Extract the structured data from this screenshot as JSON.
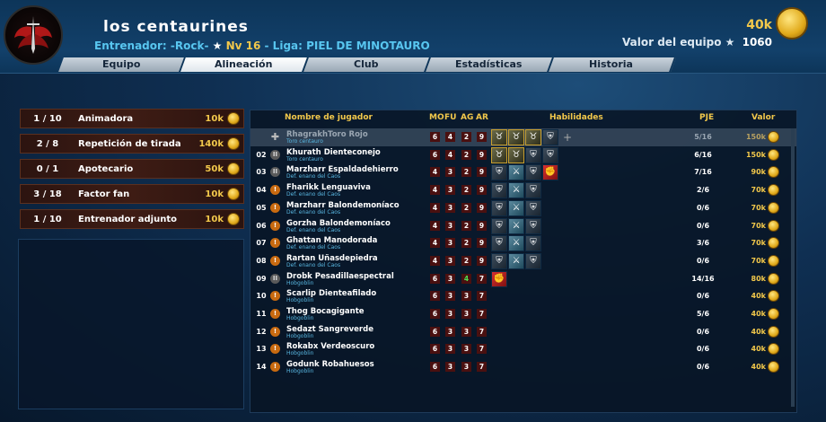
{
  "header": {
    "team_name": "los centaurines",
    "coach_prefix": "Entrenador: ",
    "coach": "-Rock-",
    "level": "Nv 16",
    "league_prefix": " - Liga: ",
    "league": "PIEL DE MINOTAURO",
    "money": "40k",
    "team_value_label": "Valor del equipo",
    "team_value": "1060"
  },
  "nav": {
    "items": [
      "Equipo",
      "Alineación",
      "Club",
      "Estadísticas",
      "Historia"
    ],
    "active": "Alineación"
  },
  "staff": [
    {
      "count": "1 / 10",
      "name": "Animadora",
      "price": "10k"
    },
    {
      "count": "2 / 8",
      "name": "Repetición de tirada",
      "price": "140k"
    },
    {
      "count": "0 / 1",
      "name": "Apotecario",
      "price": "50k"
    },
    {
      "count": "3 / 18",
      "name": "Factor fan",
      "price": "10k"
    },
    {
      "count": "1 / 10",
      "name": "Entrenador adjunto",
      "price": "10k"
    }
  ],
  "roster_headers": {
    "name": "Nombre de jugador",
    "mo": "MO",
    "fu": "FU",
    "ag": "AG",
    "ar": "AR",
    "skills": "Habilidades",
    "pje": "PJE",
    "value": "Valor"
  },
  "players": [
    {
      "num": "",
      "status": "cross",
      "name": "RhagrakhToro Rojo",
      "type": "Toro centauro",
      "mo": "6",
      "fu": "4",
      "ag": "2",
      "ar": "9",
      "skills": [
        "horn",
        "horn",
        "horn",
        "shield",
        "plus"
      ],
      "pje": "5/16",
      "value": "150k"
    },
    {
      "num": "02",
      "status": "two",
      "name": "Khurath Dienteconejo",
      "type": "Toro centauro",
      "mo": "6",
      "fu": "4",
      "ag": "2",
      "ar": "9",
      "skills": [
        "horn",
        "horn",
        "shield",
        "shield"
      ],
      "pje": "6/16",
      "value": "150k"
    },
    {
      "num": "03",
      "status": "two",
      "name": "Marzharr Espaldadehierro",
      "type": "Def. enano del Caos",
      "mo": "4",
      "fu": "3",
      "ag": "2",
      "ar": "9",
      "skills": [
        "shield",
        "claw",
        "shield",
        "red"
      ],
      "pje": "7/16",
      "value": "90k"
    },
    {
      "num": "04",
      "status": "warn",
      "name": "Fharikk Lenguaviva",
      "type": "Def. enano del Caos",
      "mo": "4",
      "fu": "3",
      "ag": "2",
      "ar": "9",
      "skills": [
        "shield",
        "claw",
        "shield"
      ],
      "pje": "2/6",
      "value": "70k"
    },
    {
      "num": "05",
      "status": "warn",
      "name": "Marzharr Balondemoníaco",
      "type": "Def. enano del Caos",
      "mo": "4",
      "fu": "3",
      "ag": "2",
      "ar": "9",
      "skills": [
        "shield",
        "claw",
        "shield"
      ],
      "pje": "0/6",
      "value": "70k"
    },
    {
      "num": "06",
      "status": "warn",
      "name": "Gorzha Balondemoníaco",
      "type": "Def. enano del Caos",
      "mo": "4",
      "fu": "3",
      "ag": "2",
      "ar": "9",
      "skills": [
        "shield",
        "claw",
        "shield"
      ],
      "pje": "0/6",
      "value": "70k"
    },
    {
      "num": "07",
      "status": "warn",
      "name": "Ghattan Manodorada",
      "type": "Def. enano del Caos",
      "mo": "4",
      "fu": "3",
      "ag": "2",
      "ar": "9",
      "skills": [
        "shield",
        "claw",
        "shield"
      ],
      "pje": "3/6",
      "value": "70k"
    },
    {
      "num": "08",
      "status": "warn",
      "name": "Rartan Uñasdepiedra",
      "type": "Def. enano del Caos",
      "mo": "4",
      "fu": "3",
      "ag": "2",
      "ar": "9",
      "skills": [
        "shield",
        "claw",
        "shield"
      ],
      "pje": "0/6",
      "value": "70k"
    },
    {
      "num": "09",
      "status": "two",
      "name": "Drobk Pesadillaespectral",
      "type": "Hobgoblin",
      "mo": "6",
      "fu": "3",
      "ag": "4",
      "ar": "7",
      "skills": [
        "red"
      ],
      "pje": "14/16",
      "value": "80k",
      "ag_green": true
    },
    {
      "num": "10",
      "status": "warn",
      "name": "Scarlip Dienteafilado",
      "type": "Hobgoblin",
      "mo": "6",
      "fu": "3",
      "ag": "3",
      "ar": "7",
      "skills": [],
      "pje": "0/6",
      "value": "40k"
    },
    {
      "num": "11",
      "status": "warn",
      "name": "Thog Bocagigante",
      "type": "Hobgoblin",
      "mo": "6",
      "fu": "3",
      "ag": "3",
      "ar": "7",
      "skills": [],
      "pje": "5/6",
      "value": "40k"
    },
    {
      "num": "12",
      "status": "warn",
      "name": "Sedazt Sangreverde",
      "type": "Hobgoblin",
      "mo": "6",
      "fu": "3",
      "ag": "3",
      "ar": "7",
      "skills": [],
      "pje": "0/6",
      "value": "40k"
    },
    {
      "num": "13",
      "status": "warn",
      "name": "Rokabx Verdeoscuro",
      "type": "Hobgoblin",
      "mo": "6",
      "fu": "3",
      "ag": "3",
      "ar": "7",
      "skills": [],
      "pje": "0/6",
      "value": "40k"
    },
    {
      "num": "14",
      "status": "warn",
      "name": "Godunk Robahuesos",
      "type": "Hobgoblin",
      "mo": "6",
      "fu": "3",
      "ag": "3",
      "ar": "7",
      "skills": [],
      "pje": "0/6",
      "value": "40k"
    }
  ]
}
